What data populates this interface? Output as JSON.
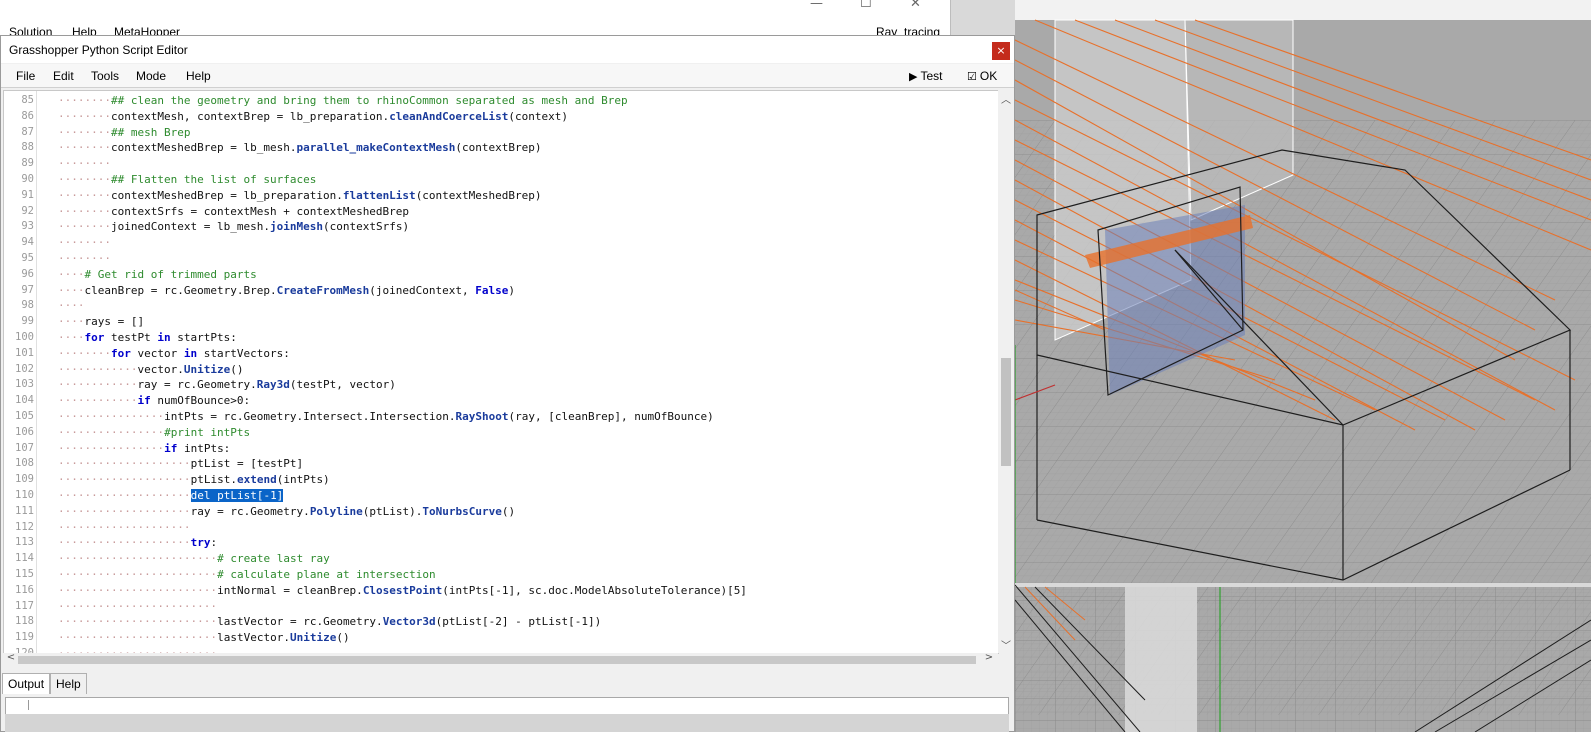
{
  "background_window": {
    "menu": [
      "Solution",
      "Help",
      "MetaHopper"
    ],
    "right_label": "Ray_tracing",
    "controls": [
      "—",
      "☐",
      "✕"
    ]
  },
  "editor": {
    "title": "Grasshopper Python Script Editor",
    "close_glyph": "×",
    "menu": [
      "File",
      "Edit",
      "Tools",
      "Mode",
      "Help"
    ],
    "test_label": "Test",
    "ok_label": "OK"
  },
  "code": {
    "selected_text": "del ptList[-1]",
    "lines": [
      {
        "num": "85",
        "ind": 2,
        "parts": [
          [
            "c",
            "## clean the geometry and bring them to rhinoCommon separated as mesh and Brep"
          ]
        ]
      },
      {
        "num": "86",
        "ind": 2,
        "parts": [
          [
            "t",
            "contextMesh, contextBrep = lb_preparation."
          ],
          [
            "f",
            "cleanAndCoerceList"
          ],
          [
            "t",
            "(context)"
          ]
        ]
      },
      {
        "num": "87",
        "ind": 2,
        "parts": [
          [
            "c",
            "## mesh Brep"
          ]
        ]
      },
      {
        "num": "88",
        "ind": 2,
        "parts": [
          [
            "t",
            "contextMeshedBrep = lb_mesh."
          ],
          [
            "f",
            "parallel_makeContextMesh"
          ],
          [
            "t",
            "(contextBrep)"
          ]
        ]
      },
      {
        "num": "89",
        "ind": 2,
        "parts": []
      },
      {
        "num": "90",
        "ind": 2,
        "parts": [
          [
            "c",
            "## Flatten the list of surfaces"
          ]
        ]
      },
      {
        "num": "91",
        "ind": 2,
        "parts": [
          [
            "t",
            "contextMeshedBrep = lb_preparation."
          ],
          [
            "f",
            "flattenList"
          ],
          [
            "t",
            "(contextMeshedBrep)"
          ]
        ]
      },
      {
        "num": "92",
        "ind": 2,
        "parts": [
          [
            "t",
            "contextSrfs = contextMesh + contextMeshedBrep"
          ]
        ]
      },
      {
        "num": "93",
        "ind": 2,
        "parts": [
          [
            "t",
            "joinedContext = lb_mesh."
          ],
          [
            "f",
            "joinMesh"
          ],
          [
            "t",
            "(contextSrfs)"
          ]
        ]
      },
      {
        "num": "94",
        "ind": 2,
        "parts": []
      },
      {
        "num": "95",
        "ind": 2,
        "parts": []
      },
      {
        "num": "96",
        "ind": 1,
        "parts": [
          [
            "c",
            "# Get rid of trimmed parts"
          ]
        ]
      },
      {
        "num": "97",
        "ind": 1,
        "parts": [
          [
            "t",
            "cleanBrep = rc.Geometry.Brep."
          ],
          [
            "f",
            "CreateFromMesh"
          ],
          [
            "t",
            "(joinedContext, "
          ],
          [
            "k",
            "False"
          ],
          [
            "t",
            ")"
          ]
        ]
      },
      {
        "num": "98",
        "ind": 1,
        "parts": []
      },
      {
        "num": "99",
        "ind": 1,
        "parts": [
          [
            "t",
            "rays = []"
          ]
        ]
      },
      {
        "num": "100",
        "ind": 1,
        "parts": [
          [
            "k",
            "for"
          ],
          [
            "t",
            " testPt "
          ],
          [
            "k",
            "in"
          ],
          [
            "t",
            " startPts:"
          ]
        ]
      },
      {
        "num": "101",
        "ind": 2,
        "parts": [
          [
            "k",
            "for"
          ],
          [
            "t",
            " vector "
          ],
          [
            "k",
            "in"
          ],
          [
            "t",
            " startVectors:"
          ]
        ]
      },
      {
        "num": "102",
        "ind": 3,
        "parts": [
          [
            "t",
            "vector."
          ],
          [
            "f",
            "Unitize"
          ],
          [
            "t",
            "()"
          ]
        ]
      },
      {
        "num": "103",
        "ind": 3,
        "parts": [
          [
            "t",
            "ray = rc.Geometry."
          ],
          [
            "f",
            "Ray3d"
          ],
          [
            "t",
            "(testPt, vector)"
          ]
        ]
      },
      {
        "num": "104",
        "ind": 3,
        "parts": [
          [
            "k",
            "if"
          ],
          [
            "t",
            " numOfBounce>0:"
          ]
        ]
      },
      {
        "num": "105",
        "ind": 4,
        "parts": [
          [
            "t",
            "intPts = rc.Geometry.Intersect.Intersection."
          ],
          [
            "f",
            "RayShoot"
          ],
          [
            "t",
            "(ray, [cleanBrep], numOfBounce)"
          ]
        ]
      },
      {
        "num": "106",
        "ind": 4,
        "parts": [
          [
            "c",
            "#print intPts"
          ]
        ]
      },
      {
        "num": "107",
        "ind": 4,
        "parts": [
          [
            "k",
            "if"
          ],
          [
            "t",
            " intPts:"
          ]
        ]
      },
      {
        "num": "108",
        "ind": 5,
        "parts": [
          [
            "t",
            "ptList = [testPt]"
          ]
        ]
      },
      {
        "num": "109",
        "ind": 5,
        "parts": [
          [
            "t",
            "ptList."
          ],
          [
            "f",
            "extend"
          ],
          [
            "t",
            "(intPts)"
          ]
        ]
      },
      {
        "num": "110",
        "ind": 5,
        "parts": [
          [
            "s",
            "del ptList[-1]"
          ]
        ]
      },
      {
        "num": "111",
        "ind": 5,
        "parts": [
          [
            "t",
            "ray = rc.Geometry."
          ],
          [
            "f",
            "Polyline"
          ],
          [
            "t",
            "(ptList)."
          ],
          [
            "f",
            "ToNurbsCurve"
          ],
          [
            "t",
            "()"
          ]
        ]
      },
      {
        "num": "112",
        "ind": 5,
        "parts": []
      },
      {
        "num": "113",
        "ind": 5,
        "parts": [
          [
            "k",
            "try"
          ],
          [
            "t",
            ":"
          ]
        ]
      },
      {
        "num": "114",
        "ind": 6,
        "parts": [
          [
            "c",
            "# create last ray"
          ]
        ]
      },
      {
        "num": "115",
        "ind": 6,
        "parts": [
          [
            "c",
            "# calculate plane at intersection"
          ]
        ]
      },
      {
        "num": "116",
        "ind": 6,
        "parts": [
          [
            "t",
            "intNormal = cleanBrep."
          ],
          [
            "f",
            "ClosestPoint"
          ],
          [
            "t",
            "(intPts[-1], sc.doc.ModelAbsoluteTolerance)[5]"
          ]
        ]
      },
      {
        "num": "117",
        "ind": 6,
        "parts": []
      },
      {
        "num": "118",
        "ind": 6,
        "parts": [
          [
            "t",
            "lastVector = rc.Geometry."
          ],
          [
            "f",
            "Vector3d"
          ],
          [
            "t",
            "(ptList[-2] - ptList[-1])"
          ]
        ]
      },
      {
        "num": "119",
        "ind": 6,
        "parts": [
          [
            "t",
            "lastVector."
          ],
          [
            "f",
            "Unitize"
          ],
          [
            "t",
            "()"
          ]
        ]
      },
      {
        "num": "120",
        "ind": 6,
        "parts": []
      }
    ]
  },
  "scrollbars": {
    "up": "︿",
    "down": "﹀",
    "left": "<",
    "right": ">"
  },
  "bottom_tabs": [
    "Output",
    "Help"
  ],
  "colors": {
    "ray_orange": "#e8702a",
    "selection_blue": "#0a64c8",
    "comment_green": "#2e8b2e",
    "keyword_blue": "#0000cc"
  }
}
